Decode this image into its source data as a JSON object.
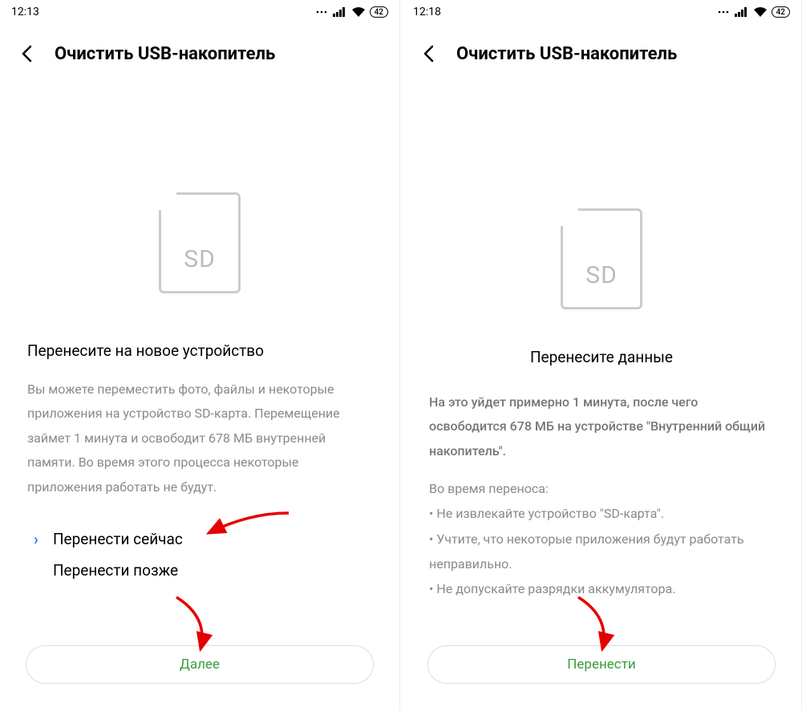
{
  "left": {
    "status": {
      "time": "12:13",
      "battery": "42"
    },
    "title": "Очистить USB-накопитель",
    "sd_label": "SD",
    "heading": "Перенесите на новое устройство",
    "paragraph": "Вы можете переместить фото, файлы и некоторые приложения на устройство SD-карта. Перемещение займет 1 минута и освободит 678 МБ внутренней памяти. Во время этого процесса некоторые приложения работать не будут.",
    "option_now": "Перенести сейчас",
    "option_later": "Перенести позже",
    "button": "Далее"
  },
  "right": {
    "status": {
      "time": "12:18",
      "battery": "42"
    },
    "title": "Очистить USB-накопитель",
    "sd_label": "SD",
    "heading": "Перенесите данные",
    "paragraph": "На это уйдет примерно 1 минута, после чего освободится 678 МБ на устройстве \"Внутренний общий накопитель\".",
    "notes_intro": "Во время переноса:",
    "note1": "• Не извлекайте устройство \"SD-карта\".",
    "note2": "• Учтите, что некоторые приложения будут работать неправильно.",
    "note3": "• Не допускайте разрядки аккумулятора.",
    "button": "Перенести"
  }
}
